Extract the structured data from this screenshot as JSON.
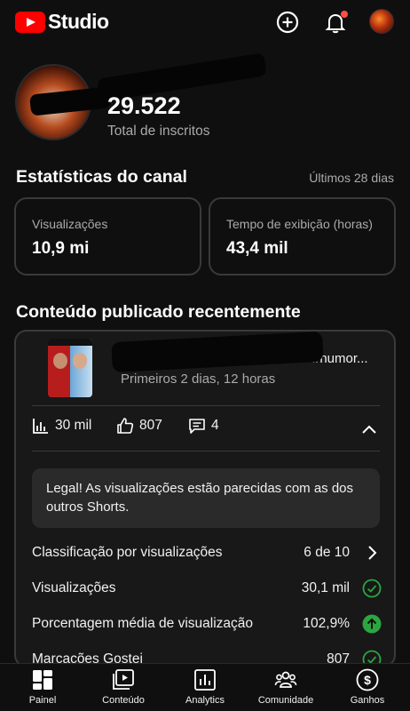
{
  "header": {
    "brand": "Studio",
    "icons": [
      "create-icon",
      "bell-icon",
      "avatar"
    ]
  },
  "channel": {
    "subscribers": "29.522",
    "subscribers_label": "Total de inscritos"
  },
  "stats": {
    "title": "Estatísticas do canal",
    "period": "Últimos 28 dias",
    "cards": [
      {
        "label": "Visualizações",
        "value": "10,9 mi"
      },
      {
        "label": "Tempo de exibição (horas)",
        "value": "43,4 mil"
      }
    ]
  },
  "recent": {
    "title": "Conteúdo publicado recentemente",
    "video": {
      "title": "#humor...",
      "subtitle": "Primeiros 2 dias, 12 horas",
      "views": "30 mil",
      "likes": "807",
      "comments": "4"
    },
    "insight": "Legal! As visualizações estão parecidas com as dos outros Shorts.",
    "rows": [
      {
        "label": "Classificação por visualizações",
        "value": "6 de 10",
        "icon": "chevron-right-icon"
      },
      {
        "label": "Visualizações",
        "value": "30,1 mil",
        "icon": "check-circle-icon"
      },
      {
        "label": "Porcentagem média de visualização",
        "value": "102,9%",
        "icon": "arrow-up-circle-icon"
      },
      {
        "label": "Marcações Gostei",
        "value": "807",
        "icon": "check-circle-icon"
      }
    ]
  },
  "nav": [
    {
      "label": "Painel",
      "icon": "dashboard-icon"
    },
    {
      "label": "Conteúdo",
      "icon": "content-icon"
    },
    {
      "label": "Analytics",
      "icon": "analytics-icon"
    },
    {
      "label": "Comunidade",
      "icon": "community-icon"
    },
    {
      "label": "Ganhos",
      "icon": "earnings-icon"
    }
  ],
  "colors": {
    "background": "#0f0f0f",
    "brand_red": "#ff0000",
    "success_green": "#2ba640",
    "muted_text": "#aaaaaa"
  }
}
